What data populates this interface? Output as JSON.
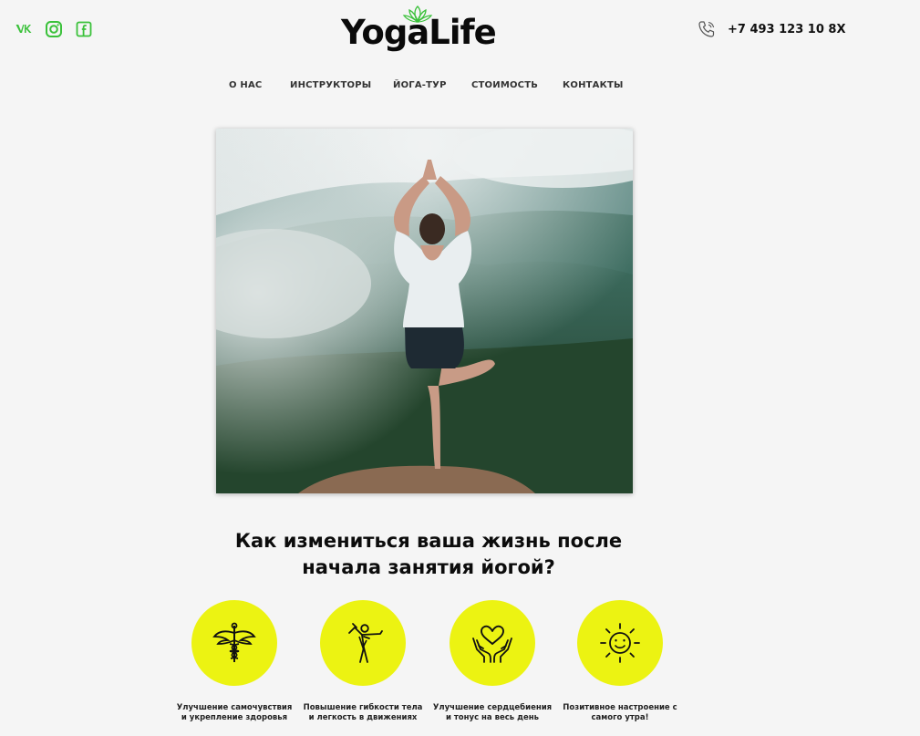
{
  "header": {
    "social": [
      {
        "name": "vk-icon",
        "label": "VK"
      },
      {
        "name": "instagram-icon",
        "label": "Instagram"
      },
      {
        "name": "facebook-icon",
        "label": "Facebook"
      }
    ],
    "logo_text": "YogaLife",
    "logo_icon": "lotus-icon",
    "phone_icon": "phone-icon",
    "phone": "+7 493 123 10 8X"
  },
  "nav": {
    "items": [
      "О НАС",
      "ИНСТРУКТОРЫ",
      "ЙОГА-ТУР",
      "СТОИМОСТЬ",
      "КОНТАКТЫ"
    ]
  },
  "hero": {
    "image": "woman-yoga-tree-pose-mountains-photo"
  },
  "benefits_section": {
    "title_line1": "Как измениться ваша жизнь после",
    "title_line2": "начала занятия йогой?",
    "items": [
      {
        "icon": "caduceus-icon",
        "line1": "Улучшение самочувствия",
        "line2": "и укрепление здоровья"
      },
      {
        "icon": "yoga-pose-icon",
        "line1": "Повышение гибкости тела",
        "line2": "и легкость в движениях"
      },
      {
        "icon": "heart-hands-icon",
        "line1": "Улучшение сердцебиения",
        "line2": "и тонус на весь день"
      },
      {
        "icon": "smiling-sun-icon",
        "line1": "Позитивное настроение с",
        "line2": "самого утра!"
      }
    ]
  },
  "colors": {
    "accent_green": "#3ac13a",
    "circle_yellow": "#ecf312",
    "background": "#f5f5f5",
    "text": "#111111"
  }
}
